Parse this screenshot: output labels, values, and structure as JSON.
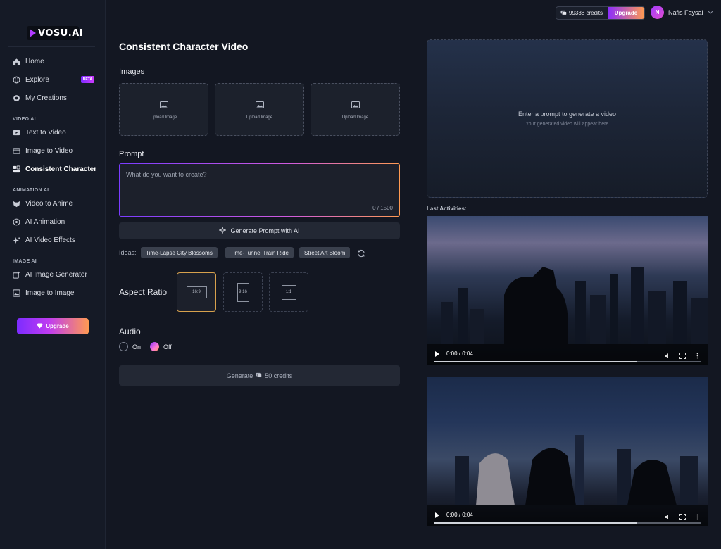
{
  "brand": {
    "logo_text": "VOSU.AI"
  },
  "header": {
    "credits": "99338 credits",
    "upgrade_label": "Upgrade",
    "user_initial": "N",
    "user_name": "Nafis Faysal"
  },
  "sidebar": {
    "items_top": [
      {
        "label": "Home",
        "icon": "home-icon"
      },
      {
        "label": "Explore",
        "icon": "globe-icon",
        "badge": "BETA"
      },
      {
        "label": "My Creations",
        "icon": "creations-icon"
      }
    ],
    "section_video": "VIDEO AI",
    "items_video": [
      {
        "label": "Text to Video",
        "icon": "text-video-icon"
      },
      {
        "label": "Image to Video",
        "icon": "image-video-icon"
      },
      {
        "label": "Consistent Character",
        "icon": "character-icon",
        "active": true
      }
    ],
    "section_animation": "ANIMATION AI",
    "items_animation": [
      {
        "label": "Video to Anime",
        "icon": "anime-icon"
      },
      {
        "label": "AI Animation",
        "icon": "animation-icon"
      },
      {
        "label": "AI Video Effects",
        "icon": "sparkle-icon"
      }
    ],
    "section_image": "IMAGE AI",
    "items_image": [
      {
        "label": "AI Image Generator",
        "icon": "image-gen-icon"
      },
      {
        "label": "Image to Image",
        "icon": "image-image-icon"
      }
    ],
    "upgrade_label": "Upgrade"
  },
  "main": {
    "title": "Consistent Character Video",
    "images_label": "Images",
    "upload_label": "Upload Image",
    "prompt_label": "Prompt",
    "prompt_placeholder": "What do you want to create?",
    "prompt_value": "",
    "char_count": "0 / 1500",
    "generate_prompt_label": "Generate Prompt with AI",
    "ideas_label": "Ideas:",
    "ideas": [
      "Time-Lapse City Blossoms",
      "Time-Tunnel Train Ride",
      "Street Art Bloom"
    ],
    "aspect_label": "Aspect Ratio",
    "aspect_options": [
      "16:9",
      "9:16",
      "1:1"
    ],
    "aspect_selected": "16:9",
    "audio_label": "Audio",
    "audio_on": "On",
    "audio_off": "Off",
    "audio_selected": "Off",
    "generate_label": "Generate",
    "generate_cost": "50 credits"
  },
  "preview": {
    "title": "Enter a prompt to generate a video",
    "subtitle": "Your generated video will appear here"
  },
  "activities": {
    "label": "Last Activities:",
    "videos": [
      {
        "time": "0:00 / 0:04",
        "progress": 0.76
      },
      {
        "time": "0:00 / 0:04",
        "progress": 0.76
      }
    ]
  },
  "colors": {
    "background": "#131722",
    "accent_purple": "#8a2cff",
    "accent_orange": "#ff9a52",
    "selected_border": "#d7a14d"
  }
}
